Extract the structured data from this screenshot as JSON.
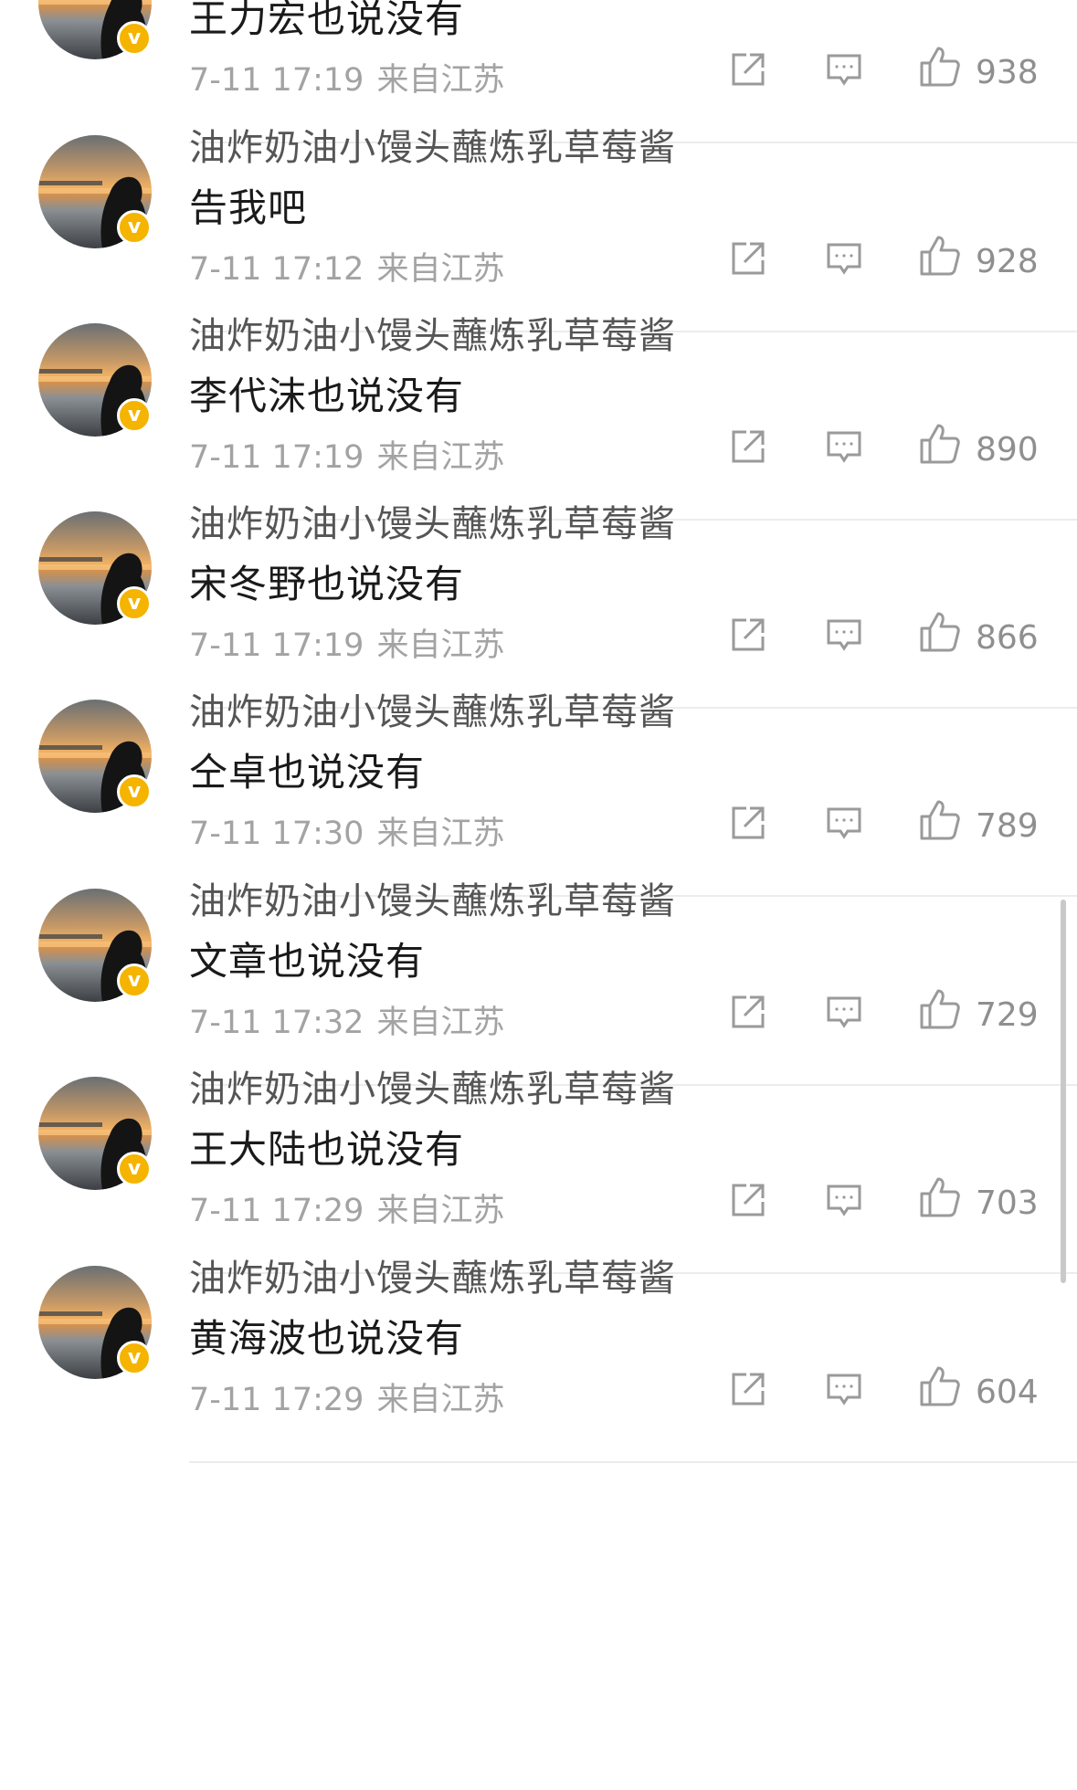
{
  "comments": [
    {
      "username": "",
      "text": "王力宏也说没有",
      "time": "7-11 17:19",
      "location": "来自江苏",
      "likes": "938"
    },
    {
      "username": "油炸奶油小馒头蘸炼乳草莓酱",
      "text": "告我吧",
      "time": "7-11 17:12",
      "location": "来自江苏",
      "likes": "928"
    },
    {
      "username": "油炸奶油小馒头蘸炼乳草莓酱",
      "text": "李代沫也说没有",
      "time": "7-11 17:19",
      "location": "来自江苏",
      "likes": "890"
    },
    {
      "username": "油炸奶油小馒头蘸炼乳草莓酱",
      "text": "宋冬野也说没有",
      "time": "7-11 17:19",
      "location": "来自江苏",
      "likes": "866"
    },
    {
      "username": "油炸奶油小馒头蘸炼乳草莓酱",
      "text": "仝卓也说没有",
      "time": "7-11 17:30",
      "location": "来自江苏",
      "likes": "789"
    },
    {
      "username": "油炸奶油小馒头蘸炼乳草莓酱",
      "text": "文章也说没有",
      "time": "7-11 17:32",
      "location": "来自江苏",
      "likes": "729"
    },
    {
      "username": "油炸奶油小馒头蘸炼乳草莓酱",
      "text": "王大陆也说没有",
      "time": "7-11 17:29",
      "location": "来自江苏",
      "likes": "703"
    },
    {
      "username": "油炸奶油小馒头蘸炼乳草莓酱",
      "text": "黄海波也说没有",
      "time": "7-11 17:29",
      "location": "来自江苏",
      "likes": "604"
    }
  ],
  "badge": {
    "glyph": "v"
  },
  "icons": {
    "share": "share-icon",
    "reply": "comment-icon",
    "like": "thumbs-up-icon",
    "verified": "verified-badge-icon"
  },
  "colors": {
    "badge": "#f5b400",
    "meta": "#a3a3a3",
    "text": "#1a1a1a",
    "username": "#555555",
    "divider": "#ececec"
  }
}
